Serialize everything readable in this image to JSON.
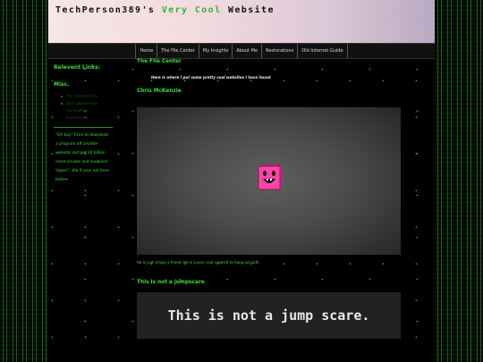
{
  "header": {
    "title_part1": "TechPerson389's ",
    "title_part2": "Very Cool",
    "title_part3": " Website"
  },
  "nav": {
    "items": [
      "Home",
      "The File Center",
      "My Insights",
      "About Me",
      "Restorations",
      "Old Internet Guide"
    ]
  },
  "sidebar": {
    "heading": "Relevent Links:",
    "subheading": "Misc.",
    "links": [
      "The internet Arch",
      "Such good image",
      "(somewhere",
      "Screenshot)"
    ],
    "quote": "\"Oh boy! Time to download a program off another website and get 10 billion more viruses and malware! Yippe!\" -the 9 year old from before"
  },
  "main": {
    "section_title": "The File Center",
    "intro": "Here is where I put some pretty cool websites I have found",
    "item1_title": "Chris McKenzie",
    "item1_caption": "He is just simply a friend. He is a very cool cubeoid to hang out with.",
    "item2_title": "This is not a jumpscare",
    "item2_video_text": "This is not a jump scare."
  },
  "colors": {
    "accent_green": "#3ddc3d",
    "cube_pink": "#ff44a8"
  }
}
